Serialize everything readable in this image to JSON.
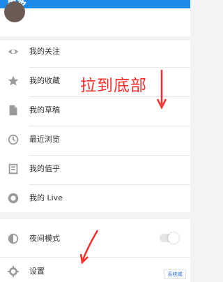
{
  "header": {
    "title": "更多"
  },
  "menu": {
    "group1": [
      {
        "label": "我的关注",
        "icon": "eye-icon"
      },
      {
        "label": "我的收藏",
        "icon": "star-icon"
      },
      {
        "label": "我的草稿",
        "icon": "document-icon"
      },
      {
        "label": "最近浏览",
        "icon": "clock-icon"
      },
      {
        "label": "我的值乎",
        "icon": "list-icon"
      },
      {
        "label": "我的 Live",
        "icon": "live-icon"
      }
    ],
    "group2": [
      {
        "label": "夜间模式",
        "icon": "moon-icon"
      },
      {
        "label": "设置",
        "icon": "gear-icon"
      }
    ]
  },
  "annotation": {
    "text": "拉到底部"
  },
  "toggle": {
    "night_mode_on": false
  },
  "colors": {
    "header": "#1e8ae8",
    "annotation": "#ff2a2a",
    "icon": "#8b8b8b"
  },
  "watermark": {
    "text": "系统城"
  }
}
